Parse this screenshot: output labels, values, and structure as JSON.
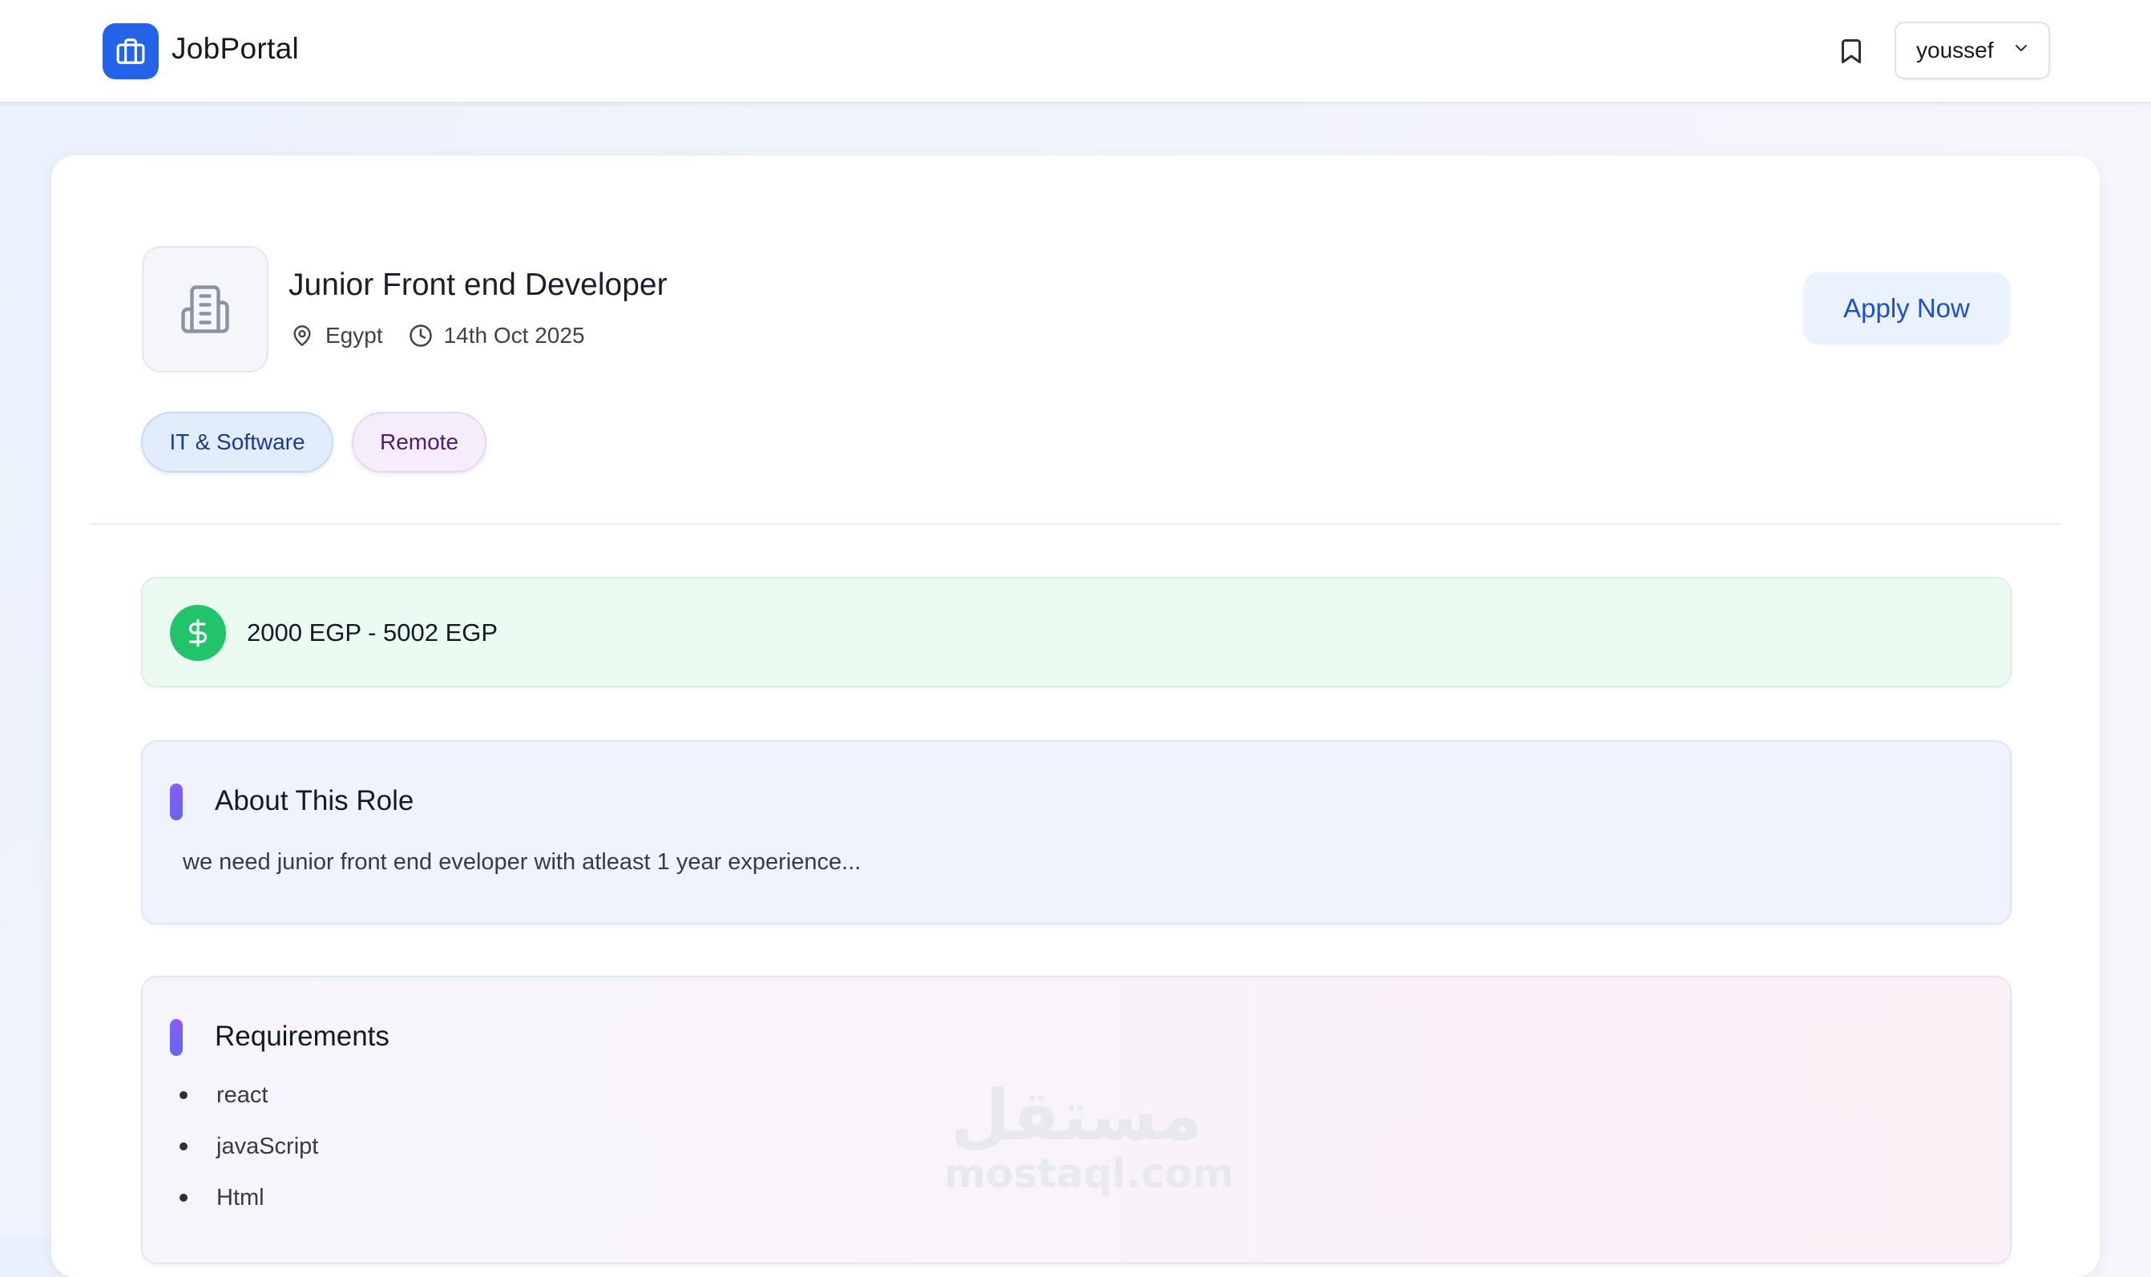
{
  "header": {
    "app_name": "JobPortal",
    "logo_icon": "briefcase-icon",
    "bookmark_icon": "bookmark-icon",
    "user_menu": {
      "username": "youssef",
      "icon": "chevron-down-icon"
    }
  },
  "job": {
    "title": "Junior Front end Developer",
    "company_logo_icon": "building-icon",
    "location": "Egypt",
    "posted_date": "14th Oct 2025",
    "apply_label": "Apply Now",
    "tags": [
      "IT & Software",
      "Remote"
    ],
    "salary": "2000 EGP - 5002 EGP"
  },
  "about": {
    "title": "About This Role",
    "text": "we need junior front end eveloper with atleast 1 year experience..."
  },
  "requirements": {
    "title": "Requirements",
    "items": [
      "react",
      "javaScript",
      "Html"
    ]
  },
  "watermark": {
    "arabic": "مستقل",
    "latin": "mostaql.com"
  },
  "colors": {
    "primary": "#2563eb",
    "salary_green": "#22c46a",
    "accent_purple": "#8b5cf6"
  }
}
